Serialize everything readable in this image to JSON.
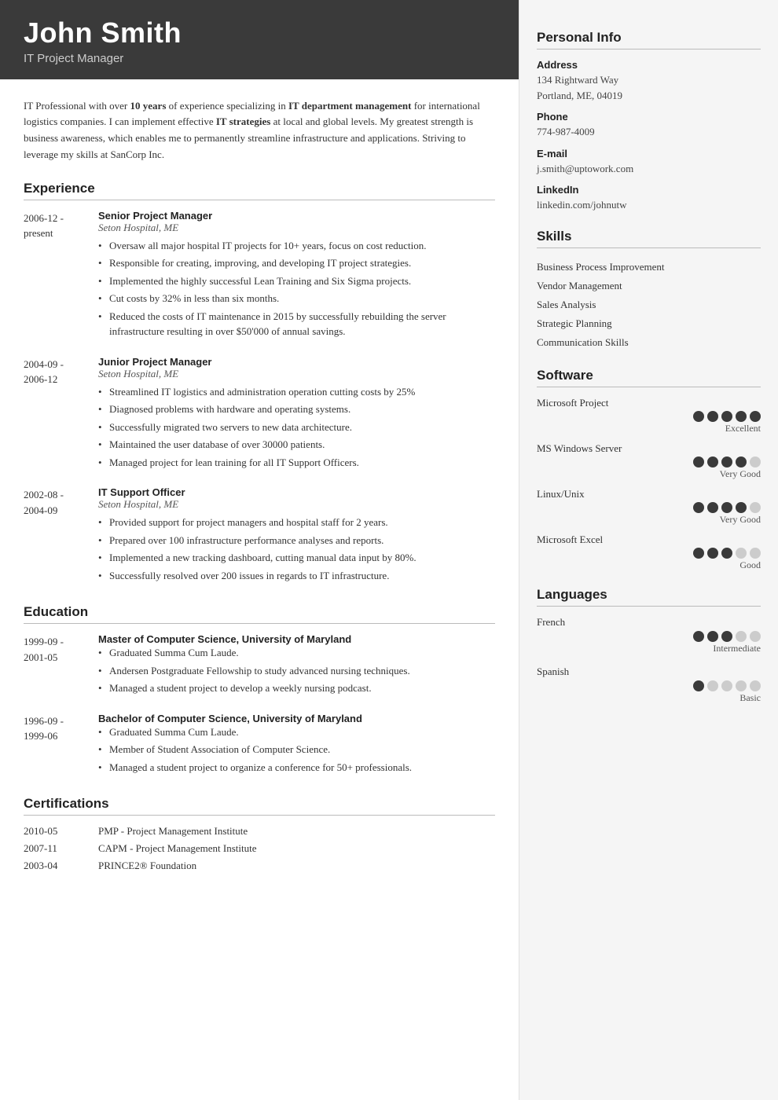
{
  "header": {
    "name": "John Smith",
    "title": "IT Project Manager"
  },
  "summary": {
    "text_parts": [
      {
        "text": "IT Professional with over ",
        "bold": false
      },
      {
        "text": "10 years",
        "bold": true
      },
      {
        "text": " of experience specializing in ",
        "bold": false
      },
      {
        "text": "IT department management",
        "bold": true
      },
      {
        "text": " for international logistics companies. I can implement effective ",
        "bold": false
      },
      {
        "text": "IT strategies",
        "bold": true
      },
      {
        "text": " at local and global levels. My greatest strength is business awareness, which enables me to permanently streamline infrastructure and applications. Striving to leverage my skills at SanCorp Inc.",
        "bold": false
      }
    ]
  },
  "sections": {
    "experience_label": "Experience",
    "education_label": "Education",
    "certifications_label": "Certifications"
  },
  "experience": [
    {
      "date_start": "2006-12 -",
      "date_end": "present",
      "title": "Senior Project Manager",
      "org": "Seton Hospital, ME",
      "bullets": [
        "Oversaw all major hospital IT projects for 10+ years, focus on cost reduction.",
        "Responsible for creating, improving, and developing IT project strategies.",
        "Implemented the highly successful Lean Training and Six Sigma projects.",
        "Cut costs by 32% in less than six months.",
        "Reduced the costs of IT maintenance in 2015 by successfully rebuilding the server infrastructure resulting in over $50'000 of annual savings."
      ]
    },
    {
      "date_start": "2004-09 -",
      "date_end": "2006-12",
      "title": "Junior Project Manager",
      "org": "Seton Hospital, ME",
      "bullets": [
        "Streamlined IT logistics and administration operation cutting costs by 25%",
        "Diagnosed problems with hardware and operating systems.",
        "Successfully migrated two servers to new data architecture.",
        "Maintained the user database of over 30000 patients.",
        "Managed project for lean training for all IT Support Officers."
      ]
    },
    {
      "date_start": "2002-08 -",
      "date_end": "2004-09",
      "title": "IT Support Officer",
      "org": "Seton Hospital, ME",
      "bullets": [
        "Provided support for project managers and hospital staff for 2 years.",
        "Prepared over 100 infrastructure performance analyses and reports.",
        "Implemented a new tracking dashboard, cutting manual data input by 80%.",
        "Successfully resolved over 200 issues in regards to IT infrastructure."
      ]
    }
  ],
  "education": [
    {
      "date_start": "1999-09 -",
      "date_end": "2001-05",
      "title": "Master of Computer Science, University of Maryland",
      "org": "",
      "bullets": [
        "Graduated Summa Cum Laude.",
        "Andersen Postgraduate Fellowship to study advanced nursing techniques.",
        "Managed a student project to develop a weekly nursing podcast."
      ]
    },
    {
      "date_start": "1996-09 -",
      "date_end": "1999-06",
      "title": "Bachelor of Computer Science, University of Maryland",
      "org": "",
      "bullets": [
        "Graduated Summa Cum Laude.",
        "Member of Student Association of Computer Science.",
        "Managed a student project to organize a conference for 50+ professionals."
      ]
    }
  ],
  "certifications": [
    {
      "date": "2010-05",
      "text": "PMP - Project Management Institute"
    },
    {
      "date": "2007-11",
      "text": "CAPM - Project Management Institute"
    },
    {
      "date": "2003-04",
      "text": "PRINCE2® Foundation"
    }
  ],
  "personal_info": {
    "label": "Personal Info",
    "address_label": "Address",
    "address_value": "134 Rightward Way\nPortland, ME, 04019",
    "phone_label": "Phone",
    "phone_value": "774-987-4009",
    "email_label": "E-mail",
    "email_value": "j.smith@uptowork.com",
    "linkedin_label": "LinkedIn",
    "linkedin_value": "linkedin.com/johnutw"
  },
  "skills": {
    "label": "Skills",
    "items": [
      "Business Process Improvement",
      "Vendor Management",
      "Sales Analysis",
      "Strategic Planning",
      "Communication Skills"
    ]
  },
  "software": {
    "label": "Software",
    "items": [
      {
        "name": "Microsoft Project",
        "filled": 5,
        "total": 5,
        "rating_label": "Excellent"
      },
      {
        "name": "MS Windows Server",
        "filled": 4,
        "total": 5,
        "rating_label": "Very Good"
      },
      {
        "name": "Linux/Unix",
        "filled": 4,
        "total": 5,
        "rating_label": "Very Good"
      },
      {
        "name": "Microsoft Excel",
        "filled": 3,
        "total": 5,
        "rating_label": "Good"
      }
    ]
  },
  "languages": {
    "label": "Languages",
    "items": [
      {
        "name": "French",
        "filled": 3,
        "total": 5,
        "rating_label": "Intermediate"
      },
      {
        "name": "Spanish",
        "filled": 1,
        "total": 5,
        "rating_label": "Basic"
      }
    ]
  }
}
